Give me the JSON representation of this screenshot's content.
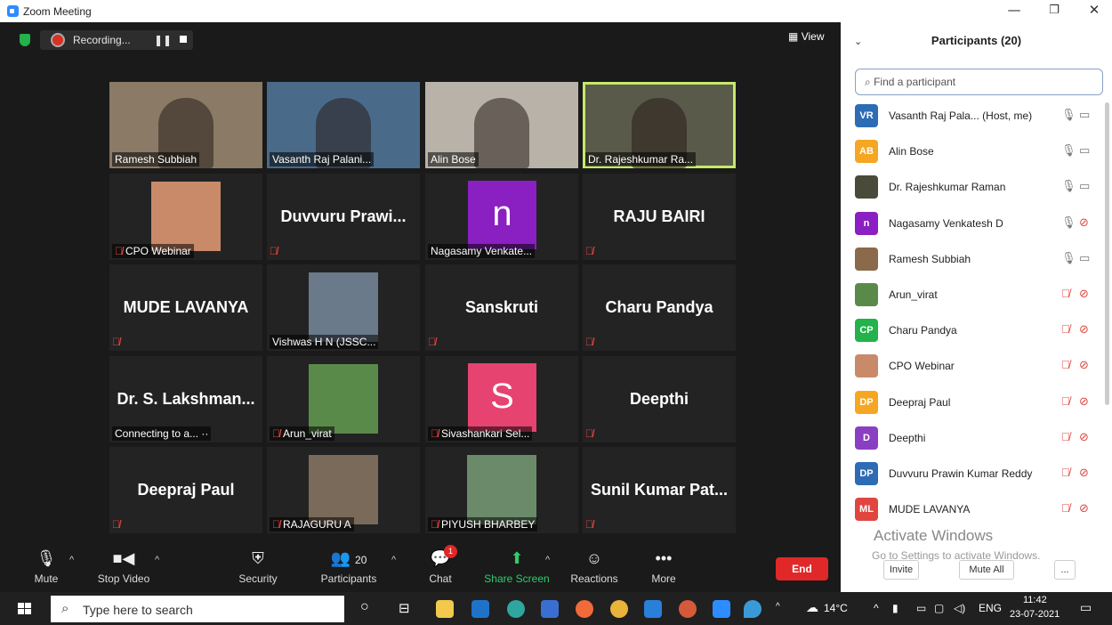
{
  "window": {
    "title": "Zoom Meeting",
    "min": "—",
    "max": "❐",
    "close": "✕"
  },
  "meeting": {
    "recording_label": "Recording...",
    "pause_label": "❚❚",
    "view_label": "View",
    "tiles": [
      {
        "label": "Ramesh Subbiah",
        "type": "video",
        "photo": "#8a7a66"
      },
      {
        "label": "Vasanth Raj Palani...",
        "type": "video",
        "photo": "#4a6a8a"
      },
      {
        "label": "Alin Bose",
        "type": "video",
        "photo": "#b8b2a8"
      },
      {
        "label": "Dr. Rajeshkumar Ra...",
        "type": "video",
        "photo": "#5a5a4a",
        "active": true
      },
      {
        "label": "CPO Webinar",
        "type": "photo",
        "photo": "#c98a6a",
        "muted": true
      },
      {
        "big": "Duvvuru Prawi...",
        "type": "name",
        "muted": true
      },
      {
        "label": "Nagasamy Venkate...",
        "type": "avatar",
        "letter": "n",
        "color": "#8a1fc2"
      },
      {
        "big": "RAJU BAIRI",
        "type": "name",
        "muted": true
      },
      {
        "big": "MUDE LAVANYA",
        "type": "name",
        "muted": true
      },
      {
        "label": "Vishwas H N (JSSC...",
        "type": "photo",
        "photo": "#6a7a8a"
      },
      {
        "big": "Sanskruti",
        "type": "name",
        "muted": true
      },
      {
        "big": "Charu Pandya",
        "type": "name",
        "muted": true
      },
      {
        "big": "Dr. S. Lakshman...",
        "type": "name",
        "status": "Connecting to a... ··"
      },
      {
        "label": "Arun_virat",
        "type": "photo",
        "photo": "#5a8a4a",
        "muted": true
      },
      {
        "label": "Sivashankari Sel...",
        "type": "avatar",
        "letter": "S",
        "color": "#e64370",
        "muted": true
      },
      {
        "big": "Deepthi",
        "type": "name",
        "muted": true
      },
      {
        "big": "Deepraj Paul",
        "type": "name",
        "muted": true
      },
      {
        "label": "RAJAGURU A",
        "type": "photo",
        "photo": "#7a6a5a",
        "muted": true
      },
      {
        "label": "PIYUSH BHARBEY",
        "type": "photo",
        "photo": "#6a8a6a",
        "muted": true
      },
      {
        "big": "Sunil Kumar Pat...",
        "type": "name",
        "muted": true
      }
    ]
  },
  "toolbar": {
    "mute": "Mute",
    "stop_video": "Stop Video",
    "security": "Security",
    "participants": "Participants",
    "participants_count": "20",
    "chat": "Chat",
    "chat_badge": "1",
    "share": "Share Screen",
    "reactions": "Reactions",
    "more": "More",
    "end": "End"
  },
  "panel": {
    "title": "Participants (20)",
    "search_placeholder": "Find a participant",
    "participants": [
      {
        "initials": "VR",
        "name": "Vasanth Raj Pala...   (Host, me)",
        "color": "#2d6bb5",
        "muted": false,
        "video_off": false
      },
      {
        "initials": "AB",
        "name": "Alin Bose",
        "color": "#f5a623",
        "muted": false,
        "video_off": false
      },
      {
        "initials": "",
        "name": "Dr. Rajeshkumar Raman",
        "color": "#4a4a3a",
        "muted": false,
        "video_off": false
      },
      {
        "initials": "n",
        "name": "Nagasamy Venkatesh D",
        "color": "#8a1fc2",
        "muted": false,
        "video_off": true
      },
      {
        "initials": "",
        "name": "Ramesh Subbiah",
        "color": "#8a6a4a",
        "muted": false,
        "video_off": false
      },
      {
        "initials": "",
        "name": "Arun_virat",
        "color": "#5a8a4a",
        "muted": true,
        "video_off": true
      },
      {
        "initials": "CP",
        "name": "Charu Pandya",
        "color": "#23b24b",
        "muted": true,
        "video_off": true
      },
      {
        "initials": "",
        "name": "CPO Webinar",
        "color": "#c98a6a",
        "muted": true,
        "video_off": true
      },
      {
        "initials": "DP",
        "name": "Deepraj Paul",
        "color": "#f5a623",
        "muted": true,
        "video_off": true
      },
      {
        "initials": "D",
        "name": "Deepthi",
        "color": "#8a3fc2",
        "muted": true,
        "video_off": true
      },
      {
        "initials": "DP",
        "name": "Duvvuru Prawin Kumar Reddy",
        "color": "#2d6bb5",
        "muted": true,
        "video_off": true
      },
      {
        "initials": "ML",
        "name": "MUDE LAVANYA",
        "color": "#e0463f",
        "muted": true,
        "video_off": true
      }
    ],
    "invite": "Invite",
    "mute_all": "Mute All",
    "more": "...",
    "activate_title": "Activate Windows",
    "activate_sub": "Go to Settings to activate Windows."
  },
  "taskbar": {
    "search": "Type here to search",
    "temp": "14°C",
    "lang": "ENG",
    "time": "11:42",
    "date": "23-07-2021"
  }
}
